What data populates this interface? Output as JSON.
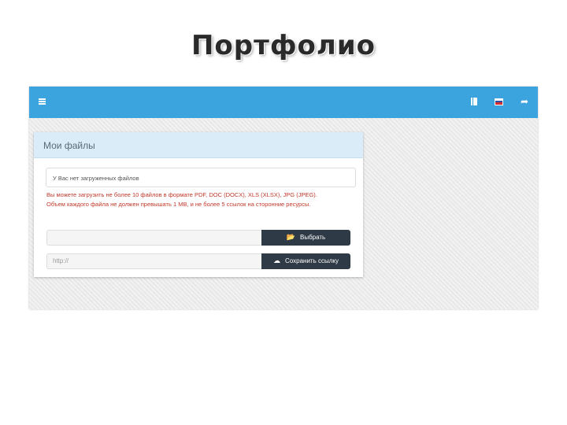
{
  "slide": {
    "title": "Портфолио"
  },
  "app": {
    "topbar": {
      "color": "#3ba3dd",
      "icons": [
        "menu-icon",
        "book-icon",
        "russian-flag-icon",
        "sign-out-icon"
      ]
    },
    "panel": {
      "title": "Мои файлы",
      "notice": "У Вас нет загруженных файлов",
      "hint_line1": "Вы можете загрузить не более 10 файлов в формате PDF, DOC (DOCX), XLS (XLSX), JPG (JPEG).",
      "hint_line2": "Объем каждого файла не должен превышать 1 MB, и не более 5 ссылок на сторонние ресурсы.",
      "file_input_value": "",
      "choose_button": "Выбрать",
      "url_placeholder": "http://",
      "save_link_button": "Сохранить ссылку"
    }
  }
}
